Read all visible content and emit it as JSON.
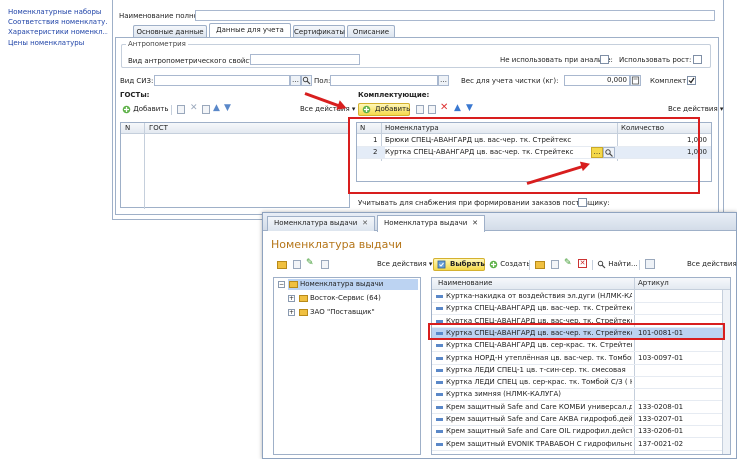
{
  "left_nav": {
    "items": [
      "Номенклатурные наборы",
      "Соответствия номенклату...",
      "Характеристики номенкл...",
      "Цены номенклатуры"
    ]
  },
  "form": {
    "name_full_label": "Наименование полное:",
    "tabs": [
      "Основные данные",
      "Данные для учета СИЗ",
      "Сертификаты",
      "Описание"
    ],
    "anthropometry": {
      "group_title": "Антропометрия",
      "type_label": "Вид антропометрического свойства:",
      "not_used_label": "Не использовать при анализе:",
      "use_height_label": "Использовать рост:"
    },
    "siz_type_label": "Вид СИЗ:",
    "gender_label": "Пол:",
    "weight_label": "Вес для учета чистки (кг):",
    "weight_value": "0,000",
    "kit_label": "Комплект:",
    "gosts": {
      "title": "ГОСТы:",
      "add_label": "Добавить",
      "all_actions": "Все действия",
      "columns": [
        "N",
        "ГОСТ"
      ]
    },
    "components": {
      "title": "Комплектующие:",
      "add_label": "Добавить",
      "all_actions": "Все действия",
      "columns": [
        "N",
        "Номенклатура",
        "Количество"
      ],
      "rows": [
        {
          "n": "1",
          "name": "Брюки СПЕЦ-АВАНГАРД цв. вас-чер. тк. Стрейтекс",
          "qty": "1,000"
        },
        {
          "n": "2",
          "name": "Куртка СПЕЦ-АВАНГАРД цв. вас-чер. тк. Стрейтекс",
          "qty": "1,000"
        }
      ]
    },
    "supply_label": "Учитывать для снабжения при формировании заказов поставщику:"
  },
  "picker": {
    "tabs": [
      "Номенклатура выдачи",
      "Номенклатура выдачи"
    ],
    "title": "Номенклатура выдачи",
    "tree_actions": "Все действия",
    "select_label": "Выбрать",
    "create_label": "Создать",
    "find_label": "Найти...",
    "list_actions": "Все действия",
    "tree": {
      "root": "Номенклатура выдачи",
      "children": [
        "Восток-Сервис (64)",
        "ЗАО \"Поставщик\""
      ]
    },
    "columns": [
      "Наименование",
      "Артикул"
    ],
    "rows": [
      {
        "name": "Куртка-накидка от воздействия эл.дуги (НЛМК-КАЛУГА)",
        "art": ""
      },
      {
        "name": "Куртка СПЕЦ-АВАНГАРД цв. вас-чер. тк. Стрейтекс Л...",
        "art": ""
      },
      {
        "name": "Куртка СПЕЦ-АВАНГАРД цв. вас-чер. тк. Стрейтекс Л...",
        "art": ""
      },
      {
        "name": "Куртка СПЕЦ-АВАНГАРД цв. вас-чер. тк. Стрейтекс",
        "art": "101-0081-01"
      },
      {
        "name": "Куртка СПЕЦ-АВАНГАРД цв. сер-крас. тк. Стрейтекс Л...",
        "art": ""
      },
      {
        "name": "Куртка НОРД-Н утеплённая цв. вас-чер. тк. Томбой",
        "art": "103-0097-01"
      },
      {
        "name": "Куртка ЛЕДИ СПЕЦ-1 цв. т-син-сер. тк. смесовая",
        "art": ""
      },
      {
        "name": "Куртка ЛЕДИ СПЕЦ цв. сер-крас. тк. Томбой С/З ( НЛ...",
        "art": ""
      },
      {
        "name": "Куртка зимняя (НЛМК-КАЛУГА)",
        "art": ""
      },
      {
        "name": "Крем защитный Safe and Care КОМБИ универсал.дейст...",
        "art": "133-0208-01"
      },
      {
        "name": "Крем защитный Safe and Care АКВА гидрофоб.действи...",
        "art": "133-0207-01"
      },
      {
        "name": "Крем защитный Safe and Care OIL гидрофил.действ...",
        "art": "133-0206-01"
      },
      {
        "name": "Крем защитный EVONIK ТРАВАБОН С гидрофильного ...",
        "art": "137-0021-02"
      }
    ],
    "selected_index": 3
  },
  "colors": {
    "accent_red": "#d81e1e",
    "selection_blue": "#bcd3f2",
    "window_title": "#b5761a"
  }
}
